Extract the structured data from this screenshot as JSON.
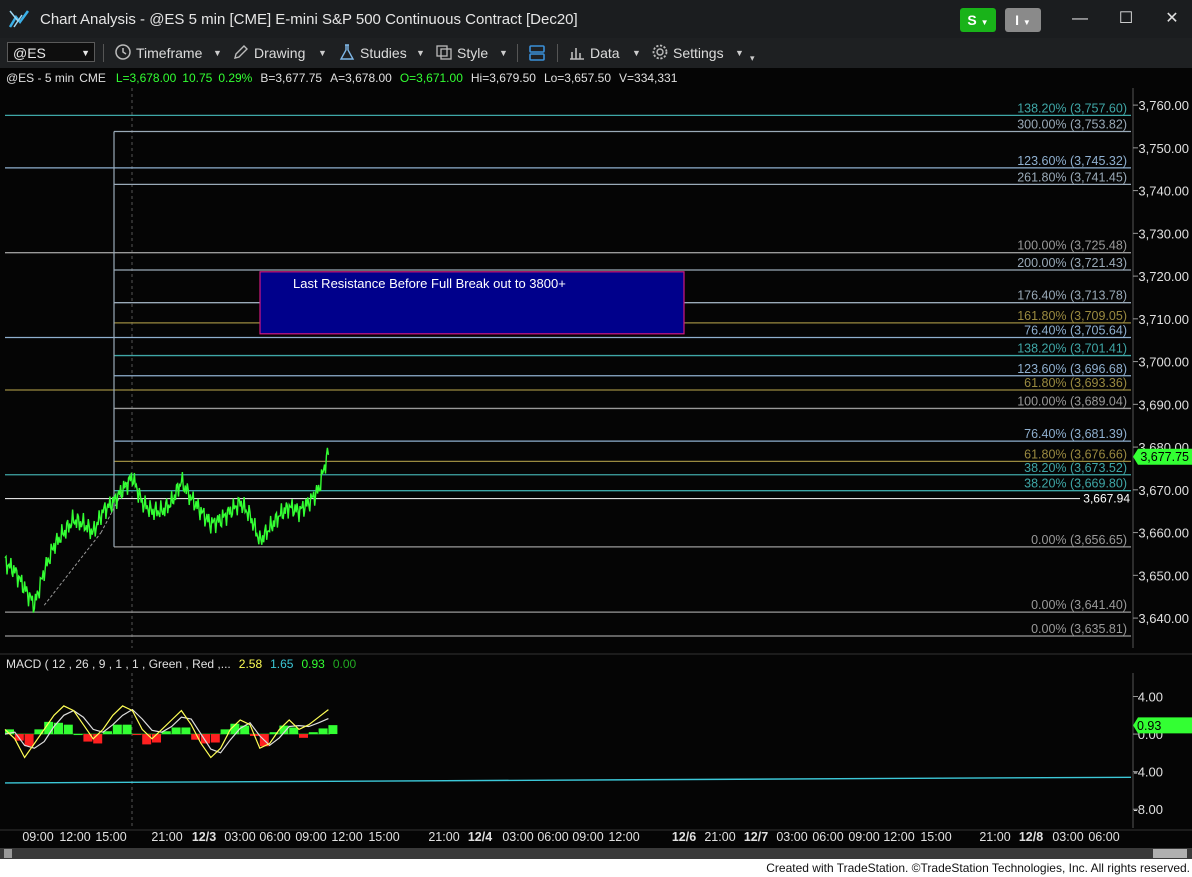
{
  "window": {
    "title": "Chart Analysis - @ES 5 min [CME] E-mini S&P 500 Continuous Contract [Dec20]",
    "s_button": "S",
    "i_button": "I",
    "minimize": "—",
    "maximize": "☐",
    "close": "✕"
  },
  "toolbar": {
    "symbol": "@ES",
    "timeframe": "Timeframe",
    "drawing": "Drawing",
    "studies": "Studies",
    "style": "Style",
    "data": "Data",
    "settings": "Settings"
  },
  "chart_data": {
    "type": "line",
    "header": {
      "symbol": "@ES - 5 min",
      "exchange": "CME",
      "last": "L=3,678.00",
      "change": "10.75",
      "change_pct": "0.29%",
      "bid": "B=3,677.75",
      "ask": "A=3,678.00",
      "open": "O=3,671.00",
      "high": "Hi=3,679.50",
      "low": "Lo=3,657.50",
      "volume": "V=334,331"
    },
    "price_axis": {
      "ticks": [
        3760,
        3750,
        3740,
        3730,
        3720,
        3710,
        3700,
        3690,
        3680,
        3670,
        3660,
        3650,
        3640
      ],
      "tick_labels": [
        "3,760.00",
        "3,750.00",
        "3,740.00",
        "3,730.00",
        "3,720.00",
        "3,710.00",
        "3,700.00",
        "3,690.00",
        "3,680.00",
        "3,670.00",
        "3,660.00",
        "3,650.00",
        "3,640.00"
      ],
      "ylim": [
        3633,
        3764
      ],
      "current_price": 3677.75,
      "current_price_label": "3,677.75",
      "line_value": 3667.94,
      "line_label": "3,667.94"
    },
    "fib_levels": [
      {
        "label": "138.20% (3,757.60)",
        "value": 3757.6,
        "color": "#3fa7a7",
        "start": "left"
      },
      {
        "label": "300.00% (3,753.82)",
        "value": 3753.82,
        "color": "#9aaab8",
        "start": "mid"
      },
      {
        "label": "123.60% (3,745.32)",
        "value": 3745.32,
        "color": "#8fb0d0",
        "start": "left"
      },
      {
        "label": "261.80% (3,741.45)",
        "value": 3741.45,
        "color": "#9aaab8",
        "start": "mid"
      },
      {
        "label": "100.00% (3,725.48)",
        "value": 3725.48,
        "color": "#9a9a9a",
        "start": "left"
      },
      {
        "label": "200.00% (3,721.43)",
        "value": 3721.43,
        "color": "#9aaab8",
        "start": "mid"
      },
      {
        "label": "176.40% (3,713.78)",
        "value": 3713.78,
        "color": "#9aaab8",
        "start": "mid"
      },
      {
        "label": "161.80% (3,709.05)",
        "value": 3709.05,
        "color": "#9a8a40",
        "start": "mid"
      },
      {
        "label": "76.40% (3,705.64)",
        "value": 3705.64,
        "color": "#8fb0d0",
        "start": "left"
      },
      {
        "label": "138.20% (3,701.41)",
        "value": 3701.41,
        "color": "#3fa7a7",
        "start": "mid"
      },
      {
        "label": "123.60% (3,696.68)",
        "value": 3696.68,
        "color": "#8fb0d0",
        "start": "mid"
      },
      {
        "label": "61.80% (3,693.36)",
        "value": 3693.36,
        "color": "#9a8a40",
        "start": "left"
      },
      {
        "label": "100.00% (3,689.04)",
        "value": 3689.04,
        "color": "#9a9a9a",
        "start": "mid"
      },
      {
        "label": "76.40% (3,681.39)",
        "value": 3681.39,
        "color": "#8fb0d0",
        "start": "mid"
      },
      {
        "label": "61.80% (3,676.66)",
        "value": 3676.66,
        "color": "#9a8a40",
        "start": "mid"
      },
      {
        "label": "38.20% (3,673.52)",
        "value": 3673.52,
        "color": "#3fa7a7",
        "start": "left"
      },
      {
        "label": "38.20% (3,669.80)",
        "value": 3669.8,
        "color": "#3fa7a7",
        "start": "mid"
      },
      {
        "label": "0.00% (3,656.65)",
        "value": 3656.65,
        "color": "#9a9a9a",
        "start": "mid"
      },
      {
        "label": "0.00% (3,641.40)",
        "value": 3641.4,
        "color": "#9a9a9a",
        "start": "left"
      },
      {
        "label": "0.00% (3,635.81)",
        "value": 3635.81,
        "color": "#9a9a9a",
        "start": "left"
      }
    ],
    "annotation": {
      "text": "Last Resistance Before Full Break out to 3800+",
      "y_top": 3721.0,
      "y_bottom": 3706.5
    },
    "price_series": {
      "name": "@ES",
      "color": "#33ff33",
      "x_bar": [
        0,
        10,
        20,
        30,
        40,
        50,
        60,
        70,
        80,
        90,
        100,
        110,
        120,
        130,
        140,
        150,
        160,
        170,
        180,
        190,
        200,
        210,
        220,
        230,
        240,
        250,
        260,
        270,
        280,
        290,
        300,
        310,
        320,
        330
      ],
      "values": [
        3653,
        3651,
        3647,
        3643,
        3651,
        3657,
        3660,
        3663,
        3662,
        3660,
        3665,
        3667,
        3670,
        3673,
        3667,
        3665,
        3665,
        3667,
        3672,
        3668,
        3665,
        3662,
        3663,
        3665,
        3667,
        3664,
        3658,
        3661,
        3664,
        3666,
        3665,
        3667,
        3670,
        3679
      ]
    },
    "time_axis": {
      "labels": [
        "09:00",
        "12:00",
        "15:00",
        "21:00",
        "12/3",
        "03:00",
        "06:00",
        "09:00",
        "12:00",
        "15:00",
        "21:00",
        "12/4",
        "03:00",
        "06:00",
        "09:00",
        "12:00",
        "12/6",
        "21:00",
        "12/7",
        "03:00",
        "06:00",
        "09:00",
        "12:00",
        "15:00",
        "21:00",
        "12/8",
        "03:00",
        "06:00"
      ],
      "bold": [
        false,
        false,
        false,
        false,
        true,
        false,
        false,
        false,
        false,
        false,
        false,
        true,
        false,
        false,
        false,
        false,
        true,
        false,
        true,
        false,
        false,
        false,
        false,
        false,
        false,
        true,
        false,
        false
      ]
    },
    "macd": {
      "header_name": "MACD ( 12 , 26 , 9 , 1 , 1 , Green , Red ,...",
      "macd_value": "2.58",
      "signal_value": "1.65",
      "hist_value": "0.93",
      "zero_value": "0.00",
      "ticks": [
        4,
        0,
        -4,
        -8
      ],
      "tick_labels": [
        "4.00",
        "0.00",
        "-4.00",
        "-8.00"
      ],
      "ylim": [
        -10,
        6.5
      ],
      "current_label": "0.93",
      "current_value": 0.93,
      "macd_series": [
        0.5,
        -0.5,
        -2.5,
        -1.0,
        0.5,
        2.0,
        3.0,
        2.5,
        1.0,
        -0.5,
        0.5,
        2.0,
        3.0,
        2.5,
        0.5,
        -0.5,
        0.5,
        1.5,
        2.5,
        1.0,
        -1.0,
        -2.5,
        -1.5,
        0.5,
        1.5,
        1.0,
        -1.5,
        -1.0,
        0.5,
        1.5,
        0.5,
        1.0,
        1.8,
        2.6
      ],
      "signal_series": [
        0.0,
        0.2,
        -1.2,
        -1.5,
        -0.8,
        0.8,
        2.0,
        2.5,
        1.8,
        0.5,
        0.2,
        1.0,
        2.0,
        2.6,
        1.6,
        0.4,
        0.2,
        0.8,
        1.8,
        1.6,
        0.0,
        -1.6,
        -2.0,
        -0.6,
        0.6,
        1.2,
        -0.2,
        -1.2,
        -0.4,
        0.8,
        0.9,
        0.8,
        1.2,
        1.65
      ],
      "trend_line": [
        -5.2,
        -4.6
      ]
    },
    "colors": {
      "background": "#050505",
      "price": "#33ff33",
      "macd_line": "#ffff55",
      "signal_line": "#dddddd",
      "hist_pos": "#33ff33",
      "hist_neg": "#ff2020",
      "trend_line": "#3cc8d8",
      "annotation_fill": "#00008b",
      "annotation_border": "#d01880"
    }
  },
  "footer": {
    "text": "Created with TradeStation. ©TradeStation Technologies, Inc. All rights reserved."
  }
}
